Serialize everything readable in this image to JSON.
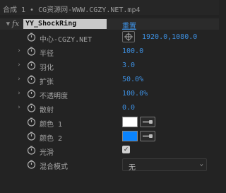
{
  "tab": {
    "title": "合成 1 • CG资源网-WWW.CGZY.NET.mp4"
  },
  "effect": {
    "fx_label": "fx",
    "name": "YY_ShockRing",
    "reset_label": "重置"
  },
  "properties": [
    {
      "label": "中心-CGZY.NET",
      "value": "1920.0,1080.0"
    },
    {
      "label": "半径",
      "value": "100.0"
    },
    {
      "label": "羽化",
      "value": "3.0"
    },
    {
      "label": "扩张",
      "value": "50.0%"
    },
    {
      "label": "不透明度",
      "value": "100.0%"
    },
    {
      "label": "散射",
      "value": "0.0"
    },
    {
      "label": "颜色 1",
      "color": "#ffffff"
    },
    {
      "label": "颜色 2",
      "color": "#0a84ff"
    },
    {
      "label": "光滑",
      "checked": true
    },
    {
      "label": "混合模式",
      "value": "无"
    }
  ],
  "colors": {
    "accent": "#3d8fe0",
    "background": "#232323",
    "color1": "#ffffff",
    "color2": "#0a84ff"
  },
  "icons": [
    "stopwatch-icon",
    "chevron-right-icon",
    "chevron-down-icon",
    "eyedropper-icon",
    "point-target-icon",
    "checkmark-icon"
  ]
}
